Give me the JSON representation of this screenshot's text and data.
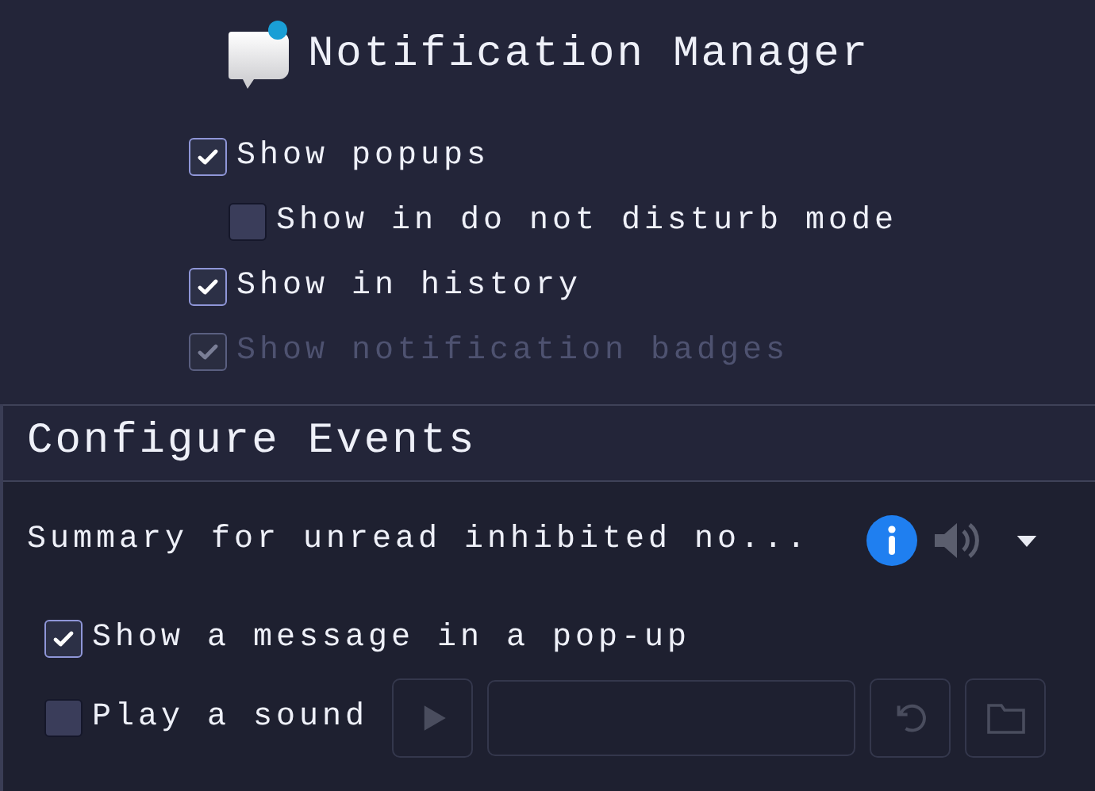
{
  "header": {
    "title": "Notification Manager"
  },
  "options": [
    {
      "label": "Show popups",
      "checked": true,
      "disabled": false,
      "children": [
        {
          "label": "Show in do not disturb mode",
          "checked": false,
          "disabled": false
        }
      ]
    },
    {
      "label": "Show in history",
      "checked": true,
      "disabled": false
    },
    {
      "label": "Show notification badges",
      "checked": true,
      "disabled": true
    }
  ],
  "configure_events": {
    "title": "Configure Events",
    "event_dropdown": {
      "value": "Summary for unread inhibited no..."
    },
    "actions": [
      {
        "kind": "checkbox",
        "label": "Show a message in a pop-up",
        "checked": true
      },
      {
        "kind": "sound",
        "label": "Play a sound",
        "checked": false,
        "controls_disabled": true
      }
    ]
  }
}
